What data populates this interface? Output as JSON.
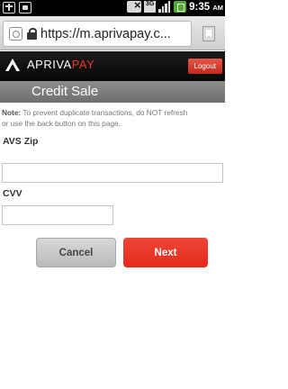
{
  "status_bar": {
    "time": "9:35",
    "ampm": "AM",
    "network": "3G"
  },
  "browser": {
    "url": "https://m.aprivapay.c..."
  },
  "header": {
    "logo_primary": "APRIVA",
    "logo_accent": "PAY",
    "logout_label": "Logout"
  },
  "page": {
    "title": "Credit Sale",
    "note_label": "Note:",
    "note_line1": " To prevent duplicate transactions, do NOT refresh",
    "note_line2": "or use the back button on this page.",
    "avs_zip_label": "AVS Zip",
    "avs_zip_value": "",
    "cvv_label": "CVV",
    "cvv_value": "",
    "cancel_label": "Cancel",
    "next_label": "Next"
  },
  "colors": {
    "brand_red": "#e32b1d",
    "header_bg": "#0e0e0e",
    "title_bar_bg": "#7d7d7d"
  }
}
